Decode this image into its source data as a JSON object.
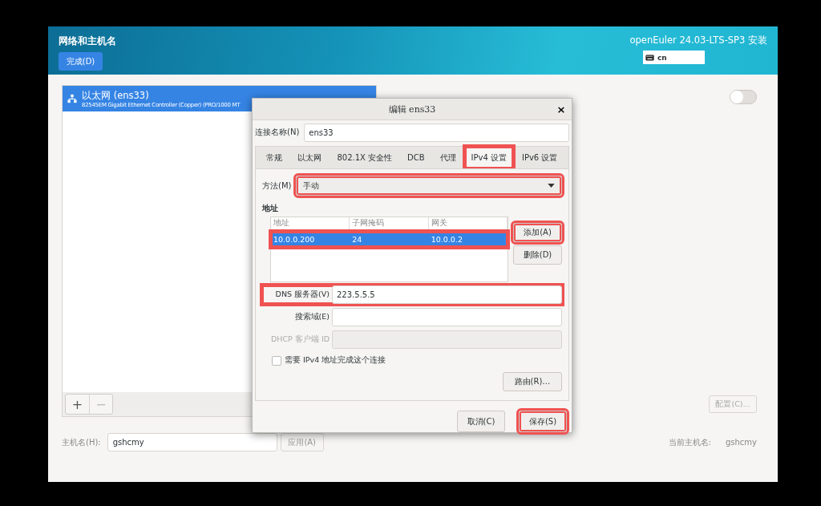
{
  "header": {
    "title": "网络和主机名",
    "done_button": "完成(D)",
    "product": "openEuler 24.03-LTS-SP3 安装",
    "keyboard_layout": "cn"
  },
  "devices": [
    {
      "name": "以太网 (ens33)",
      "description": "82545EM Gigabit Ethernet Controller (Copper) (PRO/1000 MT",
      "selected": true
    }
  ],
  "device_toolbar": {
    "add": "+",
    "remove": "−"
  },
  "device_switch": {
    "on": false
  },
  "configure_button": "配置(C)...",
  "hostname": {
    "label": "主机名(H):",
    "value": "gshcmy",
    "apply_button": "应用(A)",
    "current_label": "当前主机名:",
    "current_value": "gshcmy"
  },
  "dialog": {
    "title": "编辑 ens33",
    "close": "×",
    "connection_name_label": "连接名称(N)",
    "connection_name": "ens33",
    "tabs": [
      {
        "label": "常规",
        "selected": false,
        "highlighted": false
      },
      {
        "label": "以太网",
        "selected": false,
        "highlighted": false
      },
      {
        "label": "802.1X 安全性",
        "selected": false,
        "highlighted": false
      },
      {
        "label": "DCB",
        "selected": false,
        "highlighted": false
      },
      {
        "label": "代理",
        "selected": false,
        "highlighted": false
      },
      {
        "label": "IPv4 设置",
        "selected": true,
        "highlighted": true
      },
      {
        "label": "IPv6 设置",
        "selected": false,
        "highlighted": false
      }
    ],
    "method": {
      "label": "方法(M)",
      "value": "手动",
      "highlighted": true
    },
    "addresses_label": "地址",
    "address_table": {
      "columns": [
        "地址",
        "子网掩码",
        "网关"
      ],
      "rows": [
        {
          "cells": [
            "10.0.0.200",
            "24",
            "10.0.0.2"
          ],
          "selected": true,
          "highlighted": true
        }
      ]
    },
    "add_button": {
      "label": "添加(A)",
      "highlighted": true
    },
    "delete_button": {
      "label": "删除(D)",
      "highlighted": false
    },
    "fields": [
      {
        "label": "DNS 服务器(V)",
        "value": "223.5.5.5",
        "disabled": false,
        "highlighted": true
      },
      {
        "label": "搜索域(E)",
        "disabled": false,
        "highlighted": false
      },
      {
        "label": "DHCP 客户端 ID",
        "disabled": true,
        "highlighted": false
      }
    ],
    "require_ipv4": {
      "label": "需要 IPv4 地址完成这个连接",
      "checked": false
    },
    "routes_button": "路由(R)…",
    "cancel_button": {
      "label": "取消(C)",
      "highlighted": false
    },
    "save_button": {
      "label": "保存(S)",
      "highlighted": true
    }
  }
}
